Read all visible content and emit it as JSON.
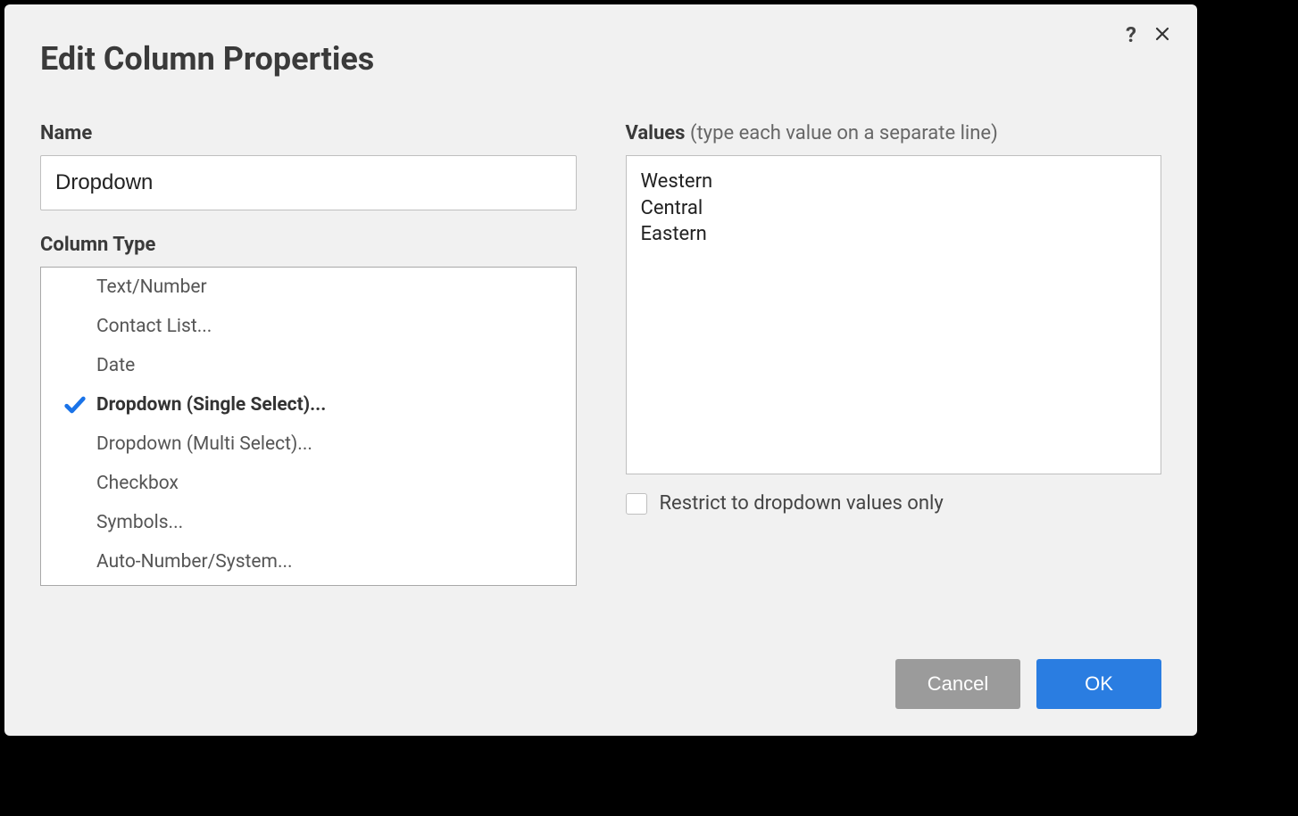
{
  "dialog": {
    "title": "Edit Column Properties",
    "name_label": "Name",
    "name_value": "Dropdown",
    "column_type_label": "Column Type",
    "types": [
      {
        "label": "Text/Number",
        "selected": false
      },
      {
        "label": "Contact List...",
        "selected": false
      },
      {
        "label": "Date",
        "selected": false
      },
      {
        "label": "Dropdown (Single Select)...",
        "selected": true
      },
      {
        "label": "Dropdown (Multi Select)...",
        "selected": false
      },
      {
        "label": "Checkbox",
        "selected": false
      },
      {
        "label": "Symbols...",
        "selected": false
      },
      {
        "label": "Auto-Number/System...",
        "selected": false
      }
    ],
    "values_label": "Values",
    "values_hint": "(type each value on a separate line)",
    "values_text": "Western\nCentral\nEastern",
    "restrict_label": "Restrict to dropdown values only",
    "restrict_checked": false,
    "cancel_label": "Cancel",
    "ok_label": "OK"
  },
  "colors": {
    "accent": "#2a7de1",
    "check": "#1a73e8"
  }
}
